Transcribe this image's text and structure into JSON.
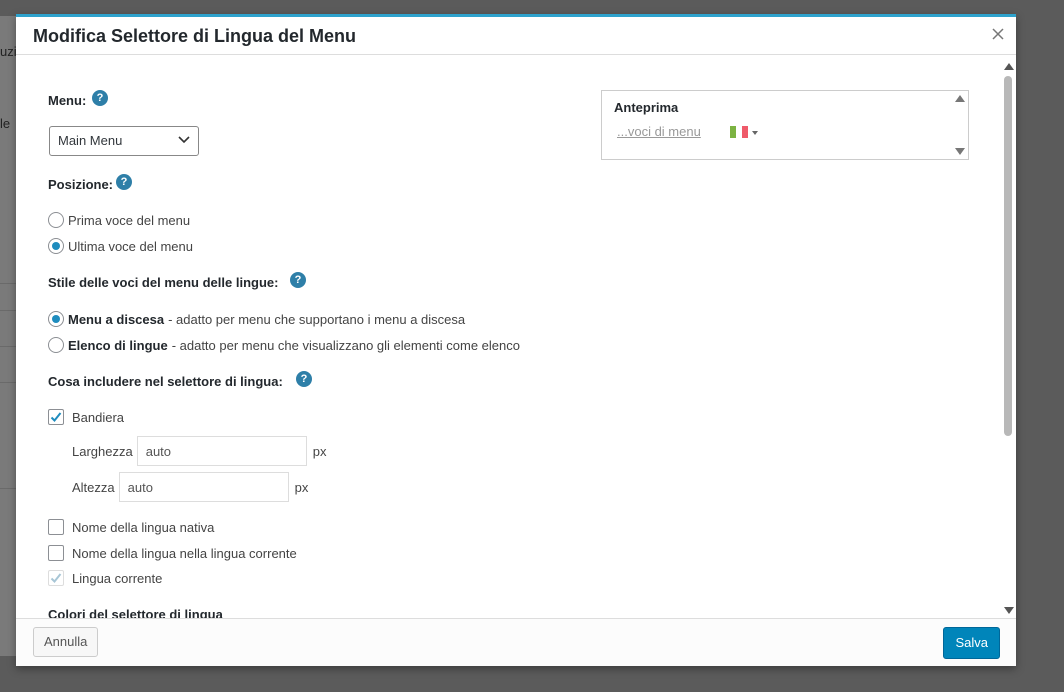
{
  "background": {
    "fragments": [
      "uzi",
      "le"
    ]
  },
  "dialog": {
    "title": "Modifica Selettore di Lingua del Menu",
    "close_icon": "close-icon"
  },
  "menu_field": {
    "label": "Menu:",
    "help": "?",
    "selected": "Main Menu"
  },
  "position": {
    "label": "Posizione:",
    "help": "?",
    "options": [
      {
        "label": "Prima voce del menu",
        "checked": false
      },
      {
        "label": "Ultima voce del menu",
        "checked": true
      }
    ]
  },
  "style": {
    "label": "Stile delle voci del menu delle lingue:",
    "help": "?",
    "options": [
      {
        "title": "Menu a discesa",
        "desc": "- adatto per menu che supportano i menu a discesa",
        "checked": true
      },
      {
        "title": "Elenco di lingue",
        "desc": "- adatto per menu che visualizzano gli elementi come elenco",
        "checked": false
      }
    ]
  },
  "include": {
    "label": "Cosa includere nel selettore di lingua:",
    "help": "?",
    "flag": {
      "label": "Bandiera",
      "checked": true
    },
    "width": {
      "label": "Larghezza",
      "value": "auto",
      "unit": "px"
    },
    "height": {
      "label": "Altezza",
      "value": "auto",
      "unit": "px"
    },
    "native_name": {
      "label": "Nome della lingua nativa",
      "checked": false
    },
    "current_name": {
      "label": "Nome della lingua nella lingua corrente",
      "checked": false
    },
    "current_language": {
      "label": "Lingua corrente",
      "checked": true,
      "disabled": true
    }
  },
  "colors": {
    "label": "Colori del selettore di lingua"
  },
  "preview": {
    "title": "Anteprima",
    "link": "...voci di menu",
    "flag_colors": [
      "#7cb342",
      "#ffffff",
      "#ef5a6a"
    ]
  },
  "footer": {
    "cancel": "Annulla",
    "save": "Salva"
  },
  "colors_theme": {
    "accent": "#2ea2cc",
    "primary_button": "#0085ba",
    "help_badge": "#2e7fa8"
  }
}
